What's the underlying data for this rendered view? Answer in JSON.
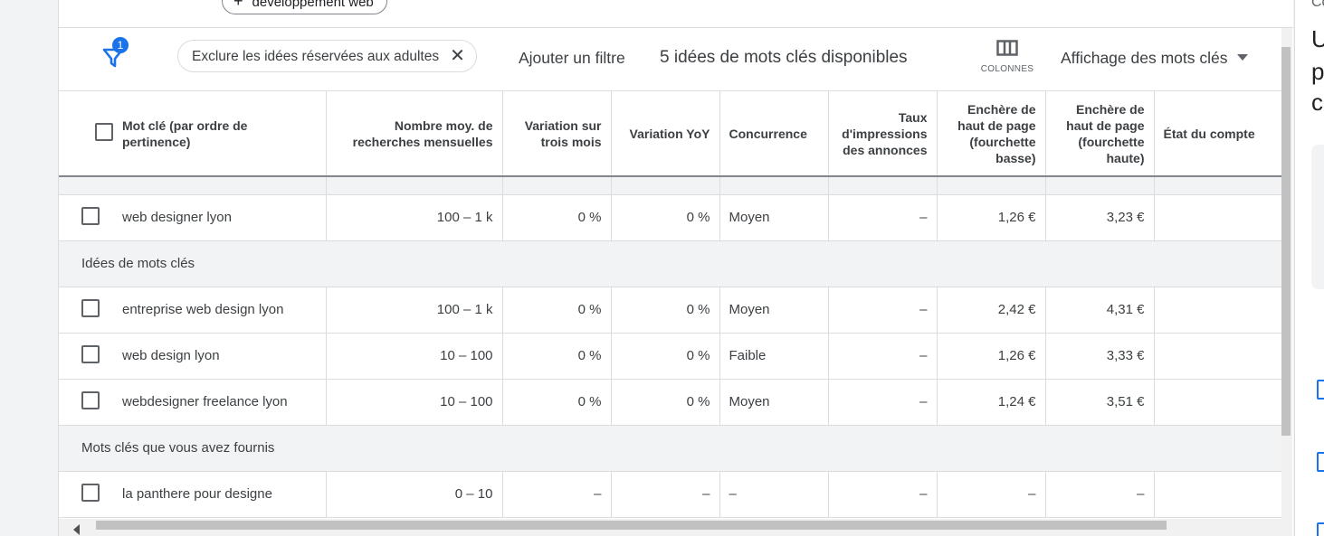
{
  "top_chip": {
    "icon": "plus-icon",
    "label": "développement web"
  },
  "filter": {
    "badge_count": "1",
    "exclude_chip_label": "Exclure les idées réservées aux adultes",
    "add_filter": "Ajouter un filtre",
    "available_count": "5 idées de mots clés disponibles",
    "columns_label": "COLONNES",
    "view_dropdown": "Affichage des mots clés"
  },
  "columns": {
    "keyword": "Mot clé (par ordre de pertinence)",
    "avg_searches": "Nombre moy. de recherches mensuelles",
    "three_month": "Variation sur trois mois",
    "yoy": "Variation YoY",
    "competition": "Concurrence",
    "impression_share": "Taux d'impressions des annonces",
    "bid_low": "Enchère de haut de page (fourchette basse)",
    "bid_high": "Enchère de haut de page (fourchette haute)",
    "account_status": "État du compte"
  },
  "rows_top": [
    {
      "keyword": "web designer lyon",
      "avg": "100 – 1 k",
      "three": "0 %",
      "yoy": "0 %",
      "comp": "Moyen",
      "imp": "–",
      "low": "1,26 €",
      "high": "3,23 €",
      "status": ""
    }
  ],
  "sections": {
    "ideas": "Idées de mots clés",
    "provided": "Mots clés que vous avez fournis"
  },
  "rows_ideas": [
    {
      "keyword": "entreprise web design lyon",
      "avg": "100 – 1 k",
      "three": "0 %",
      "yoy": "0 %",
      "comp": "Moyen",
      "imp": "–",
      "low": "2,42 €",
      "high": "4,31 €",
      "status": ""
    },
    {
      "keyword": "web design lyon",
      "avg": "10 – 100",
      "three": "0 %",
      "yoy": "0 %",
      "comp": "Faible",
      "imp": "–",
      "low": "1,26 €",
      "high": "3,33 €",
      "status": ""
    },
    {
      "keyword": "webdesigner freelance lyon",
      "avg": "10 – 100",
      "three": "0 %",
      "yoy": "0 %",
      "comp": "Moyen",
      "imp": "–",
      "low": "1,24 €",
      "high": "3,51 €",
      "status": ""
    }
  ],
  "rows_provided": [
    {
      "keyword": "la panthere pour designe",
      "avg": "0 – 10",
      "three": "–",
      "yoy": "–",
      "comp": "–",
      "imp": "–",
      "low": "–",
      "high": "–",
      "status": ""
    }
  ],
  "right_panel": {
    "small": "Co",
    "lines": [
      "U",
      "p",
      "c"
    ]
  }
}
